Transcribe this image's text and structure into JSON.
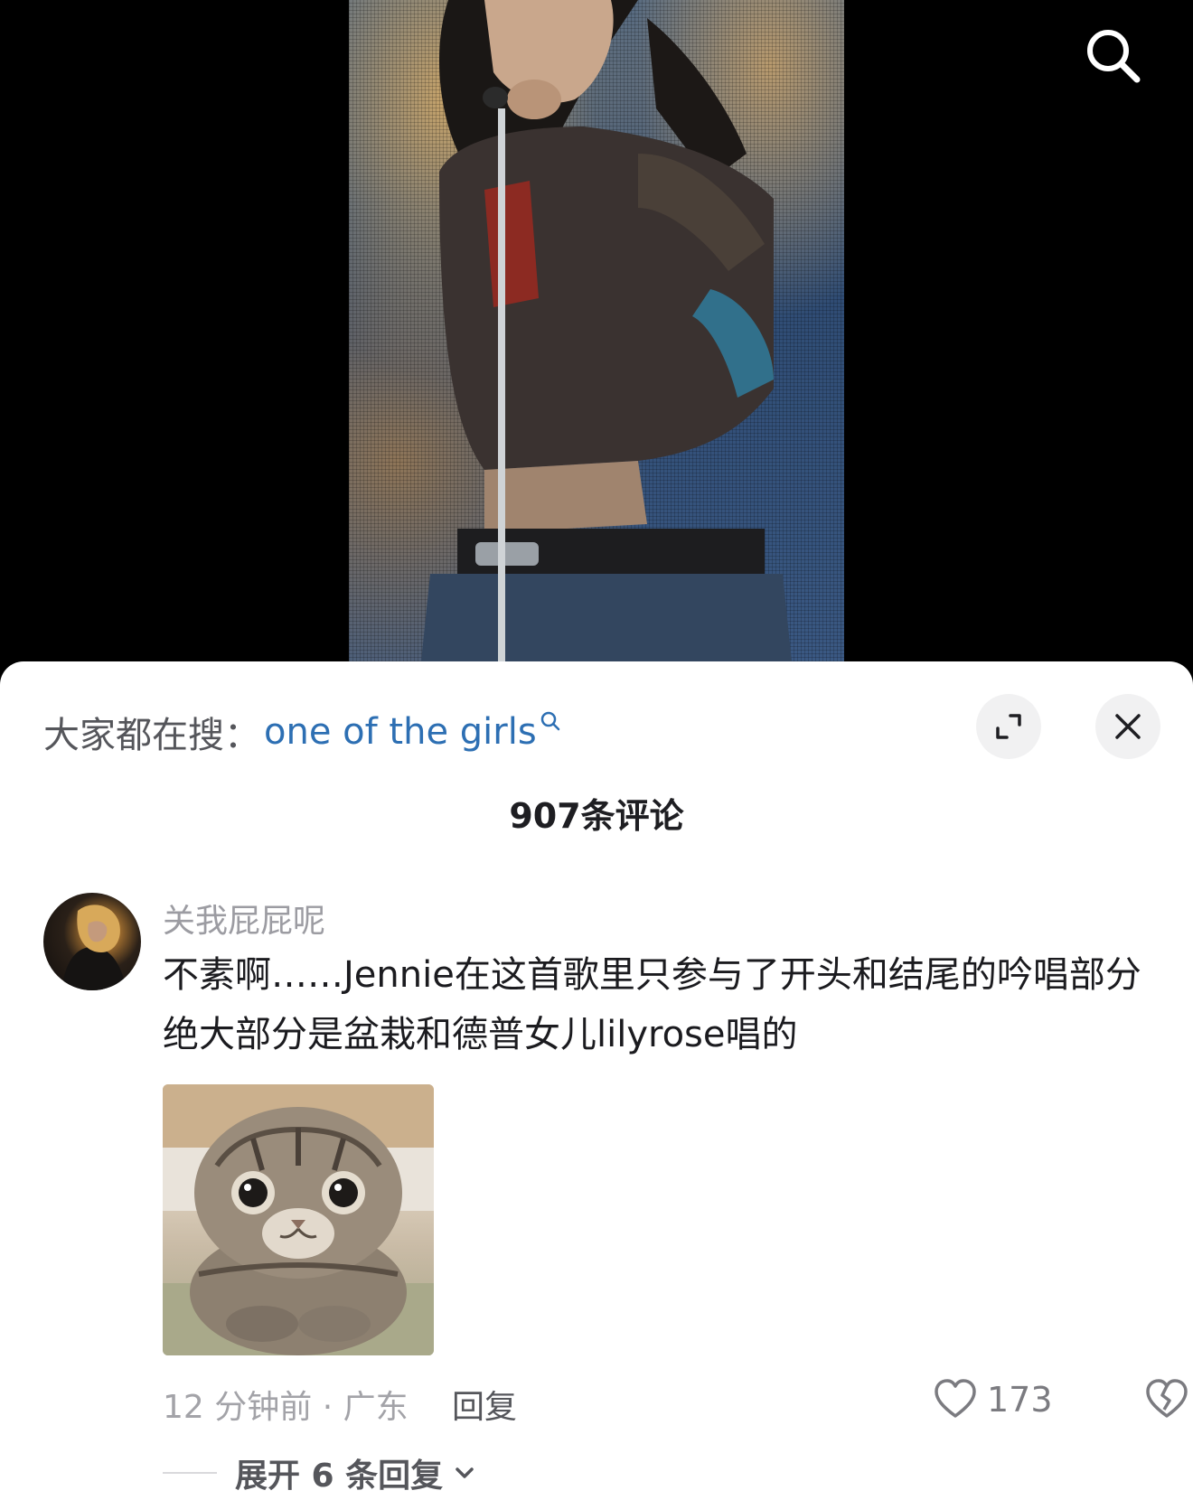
{
  "video": {
    "top_search_icon": "search-icon"
  },
  "sheet": {
    "search_prefix": "大家都在搜：",
    "search_keyword": "one of the girls",
    "search_keyword_icon": "search-icon",
    "expand_icon": "expand-icon",
    "close_icon": "close-icon",
    "comment_count": "907条评论"
  },
  "comment": {
    "username": "关我屁屁呢",
    "text": "不素啊……Jennie在这首歌里只参与了开头和结尾的吟唱部分 绝大部分是盆栽和德普女儿lilyrose唱的",
    "time_location": "12 分钟前 · 广东",
    "reply_label": "回复",
    "like_count": "173",
    "like_icon": "heart-icon",
    "dislike_icon": "broken-heart-icon",
    "expand_replies_label": "展开 6 条回复",
    "expand_chevron_icon": "chevron-down-icon"
  }
}
